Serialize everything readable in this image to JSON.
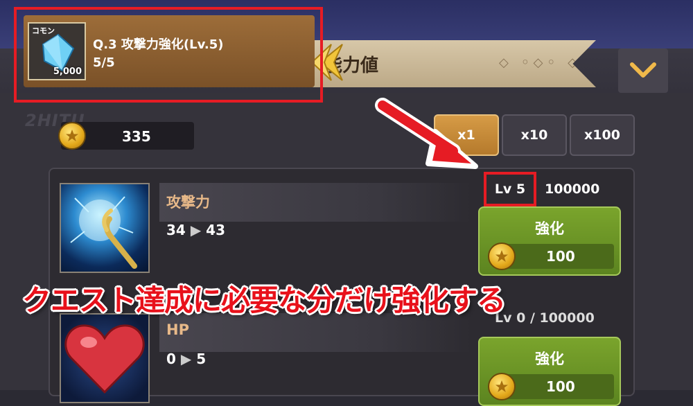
{
  "quest": {
    "item_tag": "コモン",
    "item_amount": "5,000",
    "title": "Q.3 攻撃力強化(Lv.5)",
    "progress": "5/5"
  },
  "header": {
    "ribbon_text": "能力値"
  },
  "watermark": "2HITU",
  "currency": {
    "coins": "335"
  },
  "multipliers": [
    {
      "label": "x1",
      "selected": true
    },
    {
      "label": "x10",
      "selected": false
    },
    {
      "label": "x100",
      "selected": false
    }
  ],
  "stats": [
    {
      "name": "攻撃力",
      "from": "34",
      "to": "43",
      "arrow": "▶",
      "level": "Lv 5",
      "max_level": "100000",
      "button_label": "強化",
      "cost": "100"
    },
    {
      "name": "HP",
      "from": "0",
      "to": "5",
      "arrow": "▶",
      "level_text": "Lv 0 / 100000",
      "button_label": "強化",
      "cost": "100"
    }
  ],
  "caption": "クエスト達成に必要な分だけ強化する",
  "colors": {
    "highlight_red": "#e61c24",
    "button_green": "#6f9a27",
    "selected_orange": "#c98b3b"
  }
}
